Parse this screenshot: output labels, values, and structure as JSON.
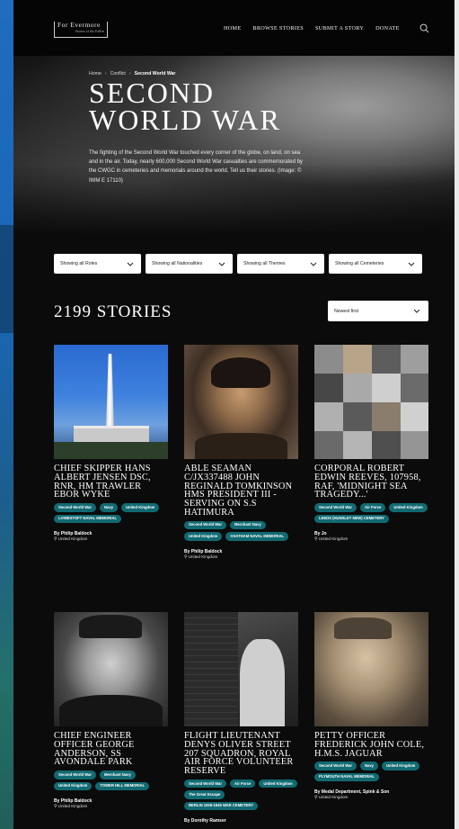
{
  "brand": {
    "name": "For Evermore",
    "tagline": "Stories of the Fallen"
  },
  "nav": {
    "items": [
      "HOME",
      "BROWSE STORIES",
      "SUBMIT A STORY",
      "DONATE"
    ],
    "search_icon": "search-icon"
  },
  "hero": {
    "breadcrumb": [
      "Home",
      "Conflict",
      "Second World War"
    ],
    "title_line1": "SECOND",
    "title_line2": "WORLD WAR",
    "description": "The fighting of the Second World War touched every corner of the globe, on land, on sea and in the air. Today, nearly 600,000 Second World War casualties are commemorated by the CWGC in cemeteries and memorials around the world. Tell us their stories. (Image: © IWM E 17110)"
  },
  "filters": [
    "Showing all Roles",
    "Showing all Nationalities",
    "Showing all Themes",
    "Showing all Cemeteries"
  ],
  "results": {
    "count": "2199 STORIES",
    "sort": "Newest first"
  },
  "stories": [
    {
      "title": "CHIEF SKIPPER HANS ALBERT JENSEN DSC, RNR, HM TRAWLER EBOR WYKE",
      "tags": [
        "Second World War",
        "Navy",
        "United Kingdom",
        "LOWESTOFT NAVAL MEMORIAL"
      ],
      "author": "By Philip Baldock",
      "location": "United Kingdom"
    },
    {
      "title": "ABLE SEAMAN C/JX337488 JOHN REGINALD TOMKINSON HMS PRESIDENT III - SERVING ON S.S HATIMURA",
      "tags": [
        "Second World War",
        "Merchant Navy",
        "United Kingdom",
        "CHATHAM NAVAL MEMORIAL"
      ],
      "author": "By Philip Baldock",
      "location": "United Kingdom"
    },
    {
      "title": "CORPORAL ROBERT EDWIN REEVES, 107958, RAF, 'MIDNIGHT SEA TRAGEDY...'",
      "tags": [
        "Second World War",
        "Air Force",
        "United Kingdom",
        "LEEDS (HUNSLET NEW) CEMETERY"
      ],
      "author": "By Jo",
      "location": "United Kingdom"
    },
    {
      "title": "CHIEF ENGINEER OFFICER GEORGE ANDERSON, SS AVONDALE PARK",
      "tags": [
        "Second World War",
        "Merchant Navy",
        "United Kingdom",
        "TOWER HILL MEMORIAL"
      ],
      "author": "By Philip Baldock",
      "location": "United Kingdom"
    },
    {
      "title": "FLIGHT LIEUTENANT DENYS OLIVER STREET 207 SQUADRON, ROYAL AIR FORCE VOLUNTEER RESERVE",
      "tags": [
        "Second World War",
        "Air Force",
        "United Kingdom",
        "The Great Escape",
        "BERLIN 1939-1945 WAR CEMETERY"
      ],
      "author": "By Dorothy Ramser",
      "location": ""
    },
    {
      "title": "PETTY OFFICER FREDERICK JOHN COLE, H.M.S. JAGUAR",
      "tags": [
        "Second World War",
        "Navy",
        "United Kingdom",
        "PLYMOUTH NAVAL MEMORIAL"
      ],
      "author": "By Medal Department, Spink & Son",
      "location": "United Kingdom"
    }
  ]
}
